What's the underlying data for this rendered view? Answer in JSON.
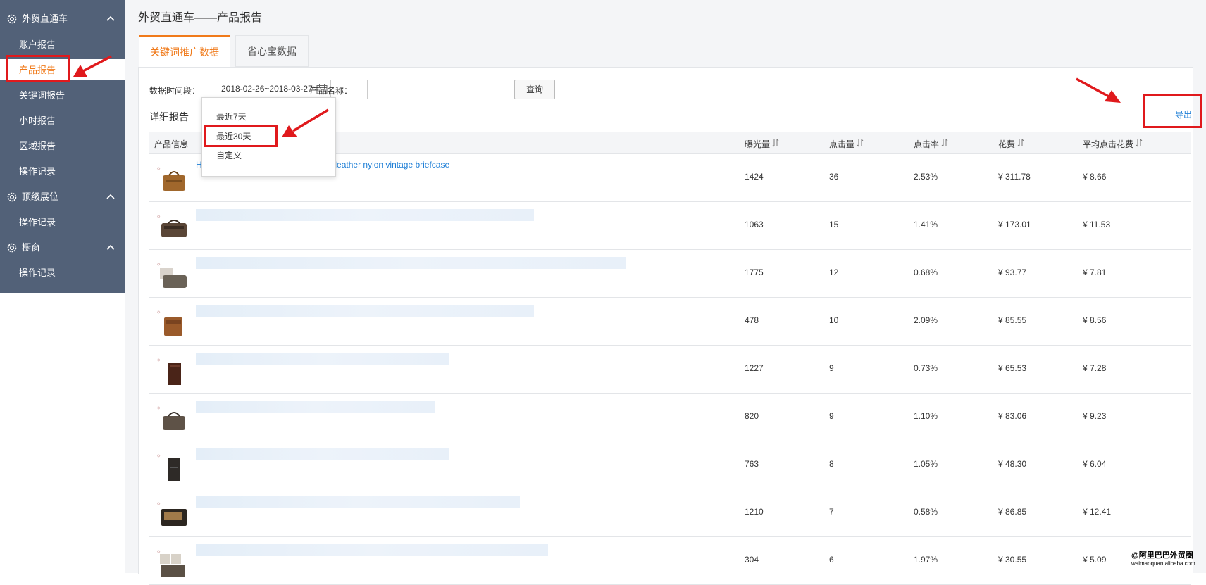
{
  "sidebar": {
    "groups": [
      {
        "label": "外贸直通车",
        "icon": "gear-icon",
        "items": [
          "账户报告",
          "产品报告",
          "关键词报告",
          "小时报告",
          "区域报告",
          "操作记录"
        ]
      },
      {
        "label": "顶级展位",
        "icon": "gear-icon",
        "items": [
          "操作记录"
        ]
      },
      {
        "label": "橱窗",
        "icon": "gear-icon",
        "items": [
          "操作记录"
        ]
      }
    ],
    "active_item": "产品报告"
  },
  "page": {
    "title": "外贸直通车——产品报告"
  },
  "tabs": [
    {
      "label": "关键词推广数据",
      "active": true
    },
    {
      "label": "省心宝数据",
      "active": false
    }
  ],
  "filters": {
    "date_label": "数据时间段：",
    "date_value": "2018-02-26~2018-03-27",
    "name_label": "产品名称：",
    "name_value": "",
    "query_button": "查询",
    "date_options": [
      "最近7天",
      "最近30天",
      "自定义"
    ],
    "highlighted_option": "最近30天"
  },
  "export_label": "导出",
  "section_title": "详细报告",
  "table": {
    "columns": [
      "产品信息",
      "曝光量",
      "点击量",
      "点击率",
      "花费",
      "平均点击花费"
    ],
    "sort_icon": "sort-icon",
    "rows": [
      {
        "title": "H",
        "title_tail": "uine business leather nylon vintage briefcase",
        "impressions": "1424",
        "clicks": "36",
        "ctr": "2.53%",
        "cost": "¥ 311.78",
        "avg_cpc": "¥ 8.66"
      },
      {
        "impressions": "1063",
        "clicks": "15",
        "ctr": "1.41%",
        "cost": "¥ 173.01",
        "avg_cpc": "¥ 11.53"
      },
      {
        "impressions": "1775",
        "clicks": "12",
        "ctr": "0.68%",
        "cost": "¥ 93.77",
        "avg_cpc": "¥ 7.81"
      },
      {
        "impressions": "478",
        "clicks": "10",
        "ctr": "2.09%",
        "cost": "¥ 85.55",
        "avg_cpc": "¥ 8.56"
      },
      {
        "impressions": "1227",
        "clicks": "9",
        "ctr": "0.73%",
        "cost": "¥ 65.53",
        "avg_cpc": "¥ 7.28"
      },
      {
        "impressions": "820",
        "clicks": "9",
        "ctr": "1.10%",
        "cost": "¥ 83.06",
        "avg_cpc": "¥ 9.23"
      },
      {
        "impressions": "763",
        "clicks": "8",
        "ctr": "1.05%",
        "cost": "¥ 48.30",
        "avg_cpc": "¥ 6.04"
      },
      {
        "impressions": "1210",
        "clicks": "7",
        "ctr": "0.58%",
        "cost": "¥ 86.85",
        "avg_cpc": "¥ 12.41"
      },
      {
        "impressions": "304",
        "clicks": "6",
        "ctr": "1.97%",
        "cost": "¥ 30.55",
        "avg_cpc": "¥ 5.09"
      }
    ]
  },
  "watermark": {
    "line1": "@阿里巴巴外贸圈",
    "line2": "waimaoquan.alibaba.com"
  },
  "colors": {
    "sidebar": "#526178",
    "accent": "#f07a1a",
    "link": "#1f7fd6",
    "annotation": "#e0191c"
  }
}
